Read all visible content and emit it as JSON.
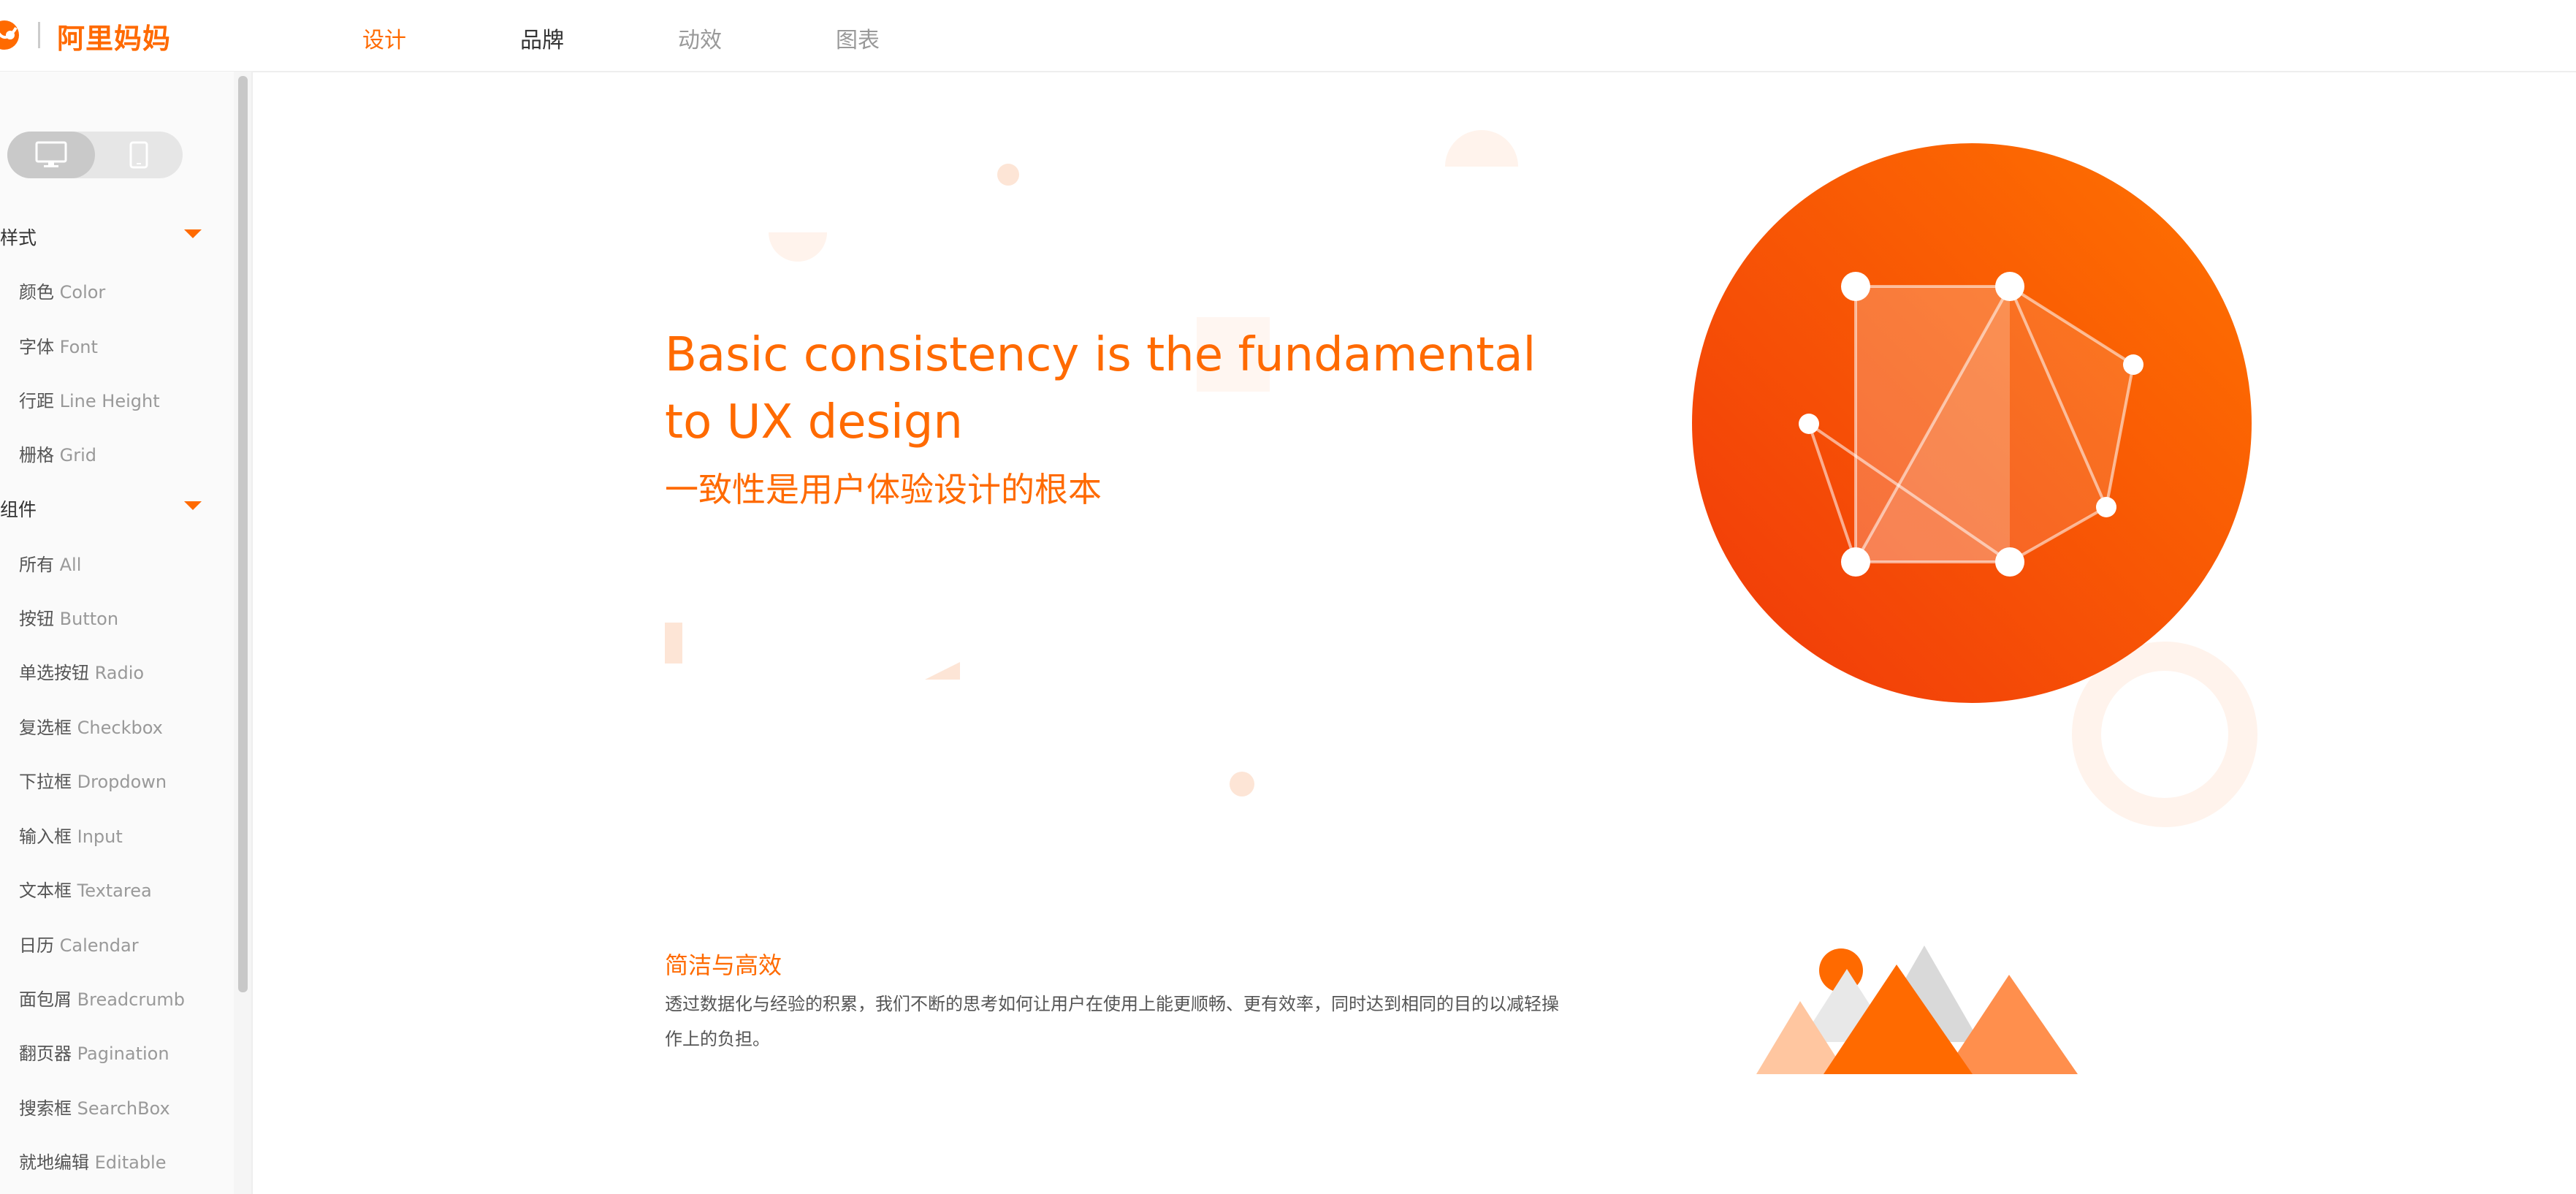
{
  "header": {
    "brand": "阿里妈妈",
    "nav": [
      {
        "label": "设计",
        "state": "active"
      },
      {
        "label": "品牌",
        "state": "normal"
      },
      {
        "label": "动效",
        "state": "muted"
      },
      {
        "label": "图表",
        "state": "muted"
      }
    ]
  },
  "sidebar": {
    "device_toggle": {
      "options": [
        "desktop-icon",
        "mobile-icon"
      ],
      "selected": "desktop-icon"
    },
    "groups": [
      {
        "title": "样式",
        "items": [
          {
            "zh": "颜色",
            "en": "Color"
          },
          {
            "zh": "字体",
            "en": "Font"
          },
          {
            "zh": "行距",
            "en": "Line Height"
          },
          {
            "zh": "栅格",
            "en": "Grid"
          }
        ]
      },
      {
        "title": "组件",
        "items": [
          {
            "zh": "所有",
            "en": "All"
          },
          {
            "zh": "按钮",
            "en": "Button"
          },
          {
            "zh": "单选按钮",
            "en": "Radio"
          },
          {
            "zh": "复选框",
            "en": "Checkbox"
          },
          {
            "zh": "下拉框",
            "en": "Dropdown"
          },
          {
            "zh": "输入框",
            "en": "Input"
          },
          {
            "zh": "文本框",
            "en": "Textarea"
          },
          {
            "zh": "日历",
            "en": "Calendar"
          },
          {
            "zh": "面包屑",
            "en": "Breadcrumb"
          },
          {
            "zh": "翻页器",
            "en": "Pagination"
          },
          {
            "zh": "搜索框",
            "en": "SearchBox"
          },
          {
            "zh": "就地编辑",
            "en": "Editable"
          }
        ]
      }
    ]
  },
  "main": {
    "hero_title": "Basic consistency is the fundamental to UX design",
    "hero_subtitle": "一致性是用户体验设计的根本",
    "section_title": "简洁与高效",
    "section_text": "透过数据化与经验的积累，我们不断的思考如何让用户在使用上能更顺畅、更有效率，同时达到相同的目的以减轻操作上的负担。"
  },
  "colors": {
    "accent": "#ff6a00",
    "accent_dark": "#f03c00",
    "muted_text": "#999999"
  }
}
